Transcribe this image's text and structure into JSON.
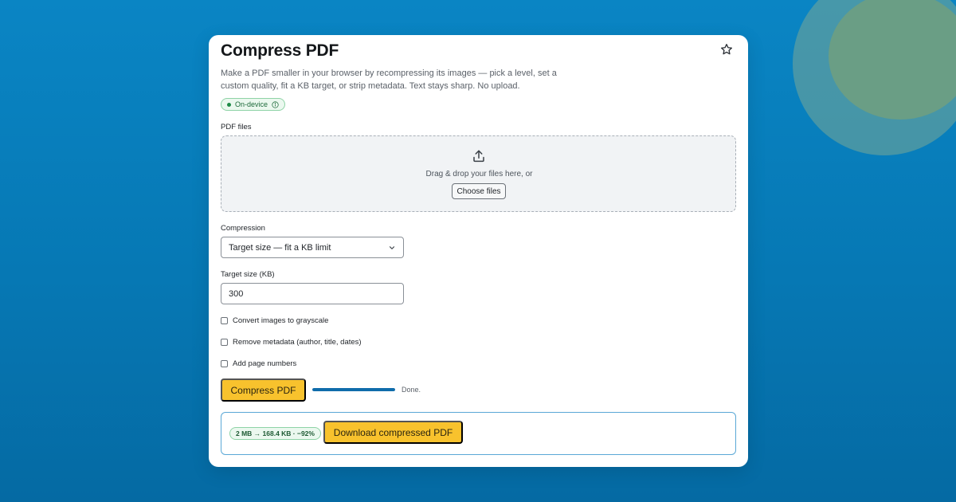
{
  "header": {
    "title": "Compress PDF"
  },
  "description": "Make a PDF smaller in your browser by recompressing its images — pick a level, set a custom quality, fit a KB target, or strip metadata. Text stays sharp. No upload.",
  "badge": {
    "label": "On-device"
  },
  "files": {
    "label": "PDF files",
    "drop_text": "Drag & drop your files here, or",
    "choose_label": "Choose files"
  },
  "compression": {
    "label": "Compression",
    "selected": "Target size — fit a KB limit"
  },
  "target": {
    "label": "Target size (KB)",
    "value": "300"
  },
  "options": [
    {
      "label": "Convert images to grayscale",
      "checked": false
    },
    {
      "label": "Remove metadata (author, title, dates)",
      "checked": false
    },
    {
      "label": "Add page numbers",
      "checked": false
    }
  ],
  "actions": {
    "compress_label": "Compress PDF"
  },
  "progress": {
    "value": 1.0,
    "text": "Done."
  },
  "result": {
    "size_summary": "2 MB → 168.4 KB · −92%",
    "download_label": "Download compressed PDF"
  },
  "colors": {
    "background": "#0a85c4",
    "accent": "#f8c22d",
    "progress": "#0f6cab",
    "success": "#1f8a47"
  },
  "icons": [
    "star-icon",
    "info-icon",
    "upload-icon",
    "chevron-down-icon"
  ]
}
